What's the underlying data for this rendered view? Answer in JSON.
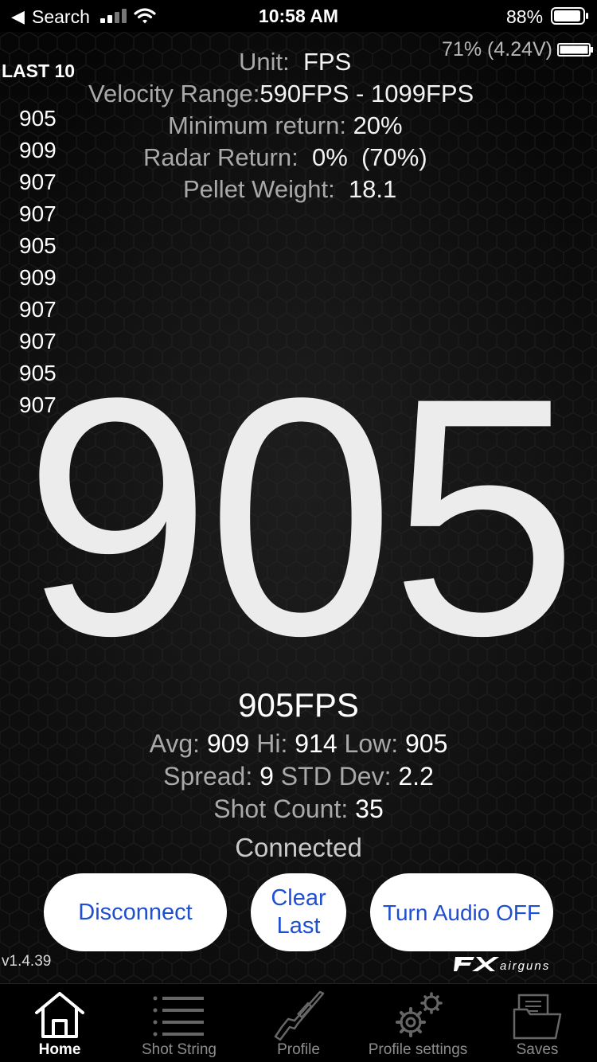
{
  "status_bar": {
    "back_label": "Search",
    "time": "10:58 AM",
    "battery_percent": "88%"
  },
  "device_battery": "71% (4.24V)",
  "last10": {
    "title": "LAST 10",
    "values": [
      "905",
      "909",
      "907",
      "907",
      "905",
      "909",
      "907",
      "907",
      "905",
      "907"
    ]
  },
  "settings": {
    "unit_label": "Unit:",
    "unit_value": "FPS",
    "range_label": "Velocity Range:",
    "range_value": "590FPS - 1099FPS",
    "min_return_label": "Minimum return:",
    "min_return_value": "20%",
    "radar_return_label": "Radar Return:",
    "radar_return_value": "0%  (70%)",
    "pellet_weight_label": "Pellet Weight:",
    "pellet_weight_value": "18.1"
  },
  "current_velocity": "905",
  "last_shot": "905FPS",
  "stats": {
    "avg_label": "Avg:",
    "avg_value": "909",
    "hi_label": "Hi:",
    "hi_value": "914",
    "low_label": "Low:",
    "low_value": "905",
    "spread_label": "Spread:",
    "spread_value": "9",
    "std_label": "STD Dev:",
    "std_value": "2.2",
    "count_label": "Shot Count:",
    "count_value": "35"
  },
  "connection_status": "Connected",
  "buttons": {
    "disconnect": "Disconnect",
    "clear_last": "Clear Last",
    "audio": "Turn Audio OFF"
  },
  "version": "v1.4.39",
  "brand": "FX airguns",
  "tabs": [
    {
      "label": "Home",
      "icon": "home-icon",
      "active": true
    },
    {
      "label": "Shot String",
      "icon": "list-icon",
      "active": false
    },
    {
      "label": "Profile",
      "icon": "rifle-icon",
      "active": false
    },
    {
      "label": "Profile settings",
      "icon": "gears-icon",
      "active": false
    },
    {
      "label": "Saves",
      "icon": "folder-icon",
      "active": false
    }
  ],
  "colors": {
    "button_text": "#1f4fd1",
    "button_bg": "#ffffff",
    "label_gray": "#a9a9a9",
    "background": "#0b0b0b"
  }
}
